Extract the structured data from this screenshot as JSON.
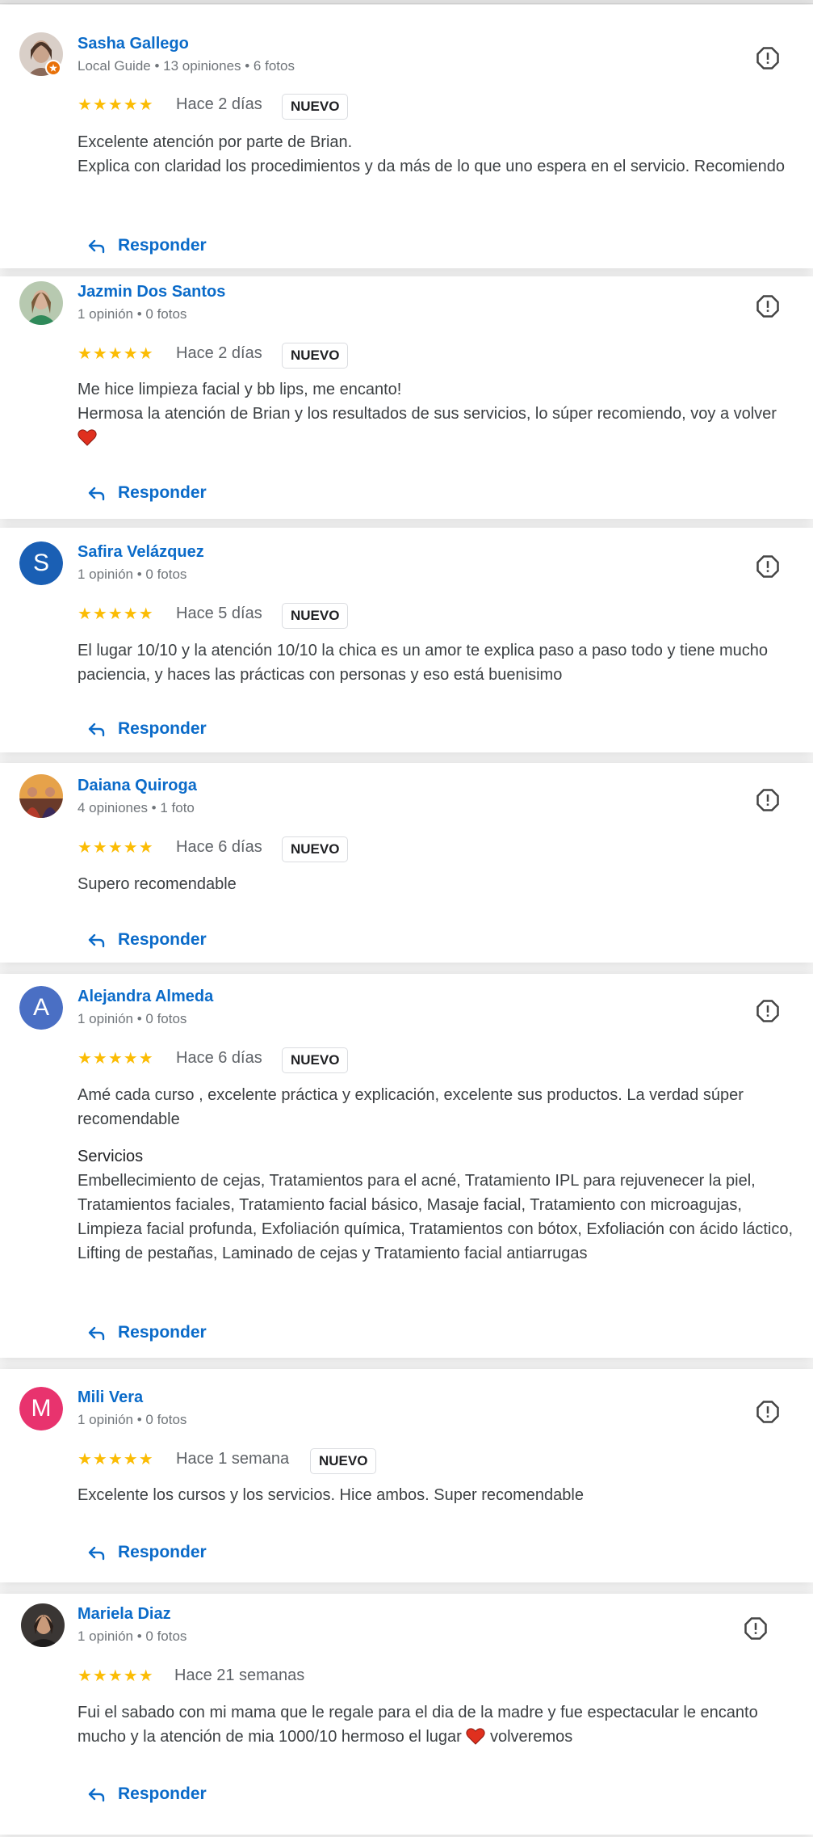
{
  "reviews": [
    {
      "name": "Sasha Gallego",
      "meta": "Local Guide • 13 opiniones • 6 fotos",
      "rating": 5,
      "stars": "★★★★★",
      "time": "Hace 2 días",
      "badge": "NUEVO",
      "lines": [
        "Excelente atención por parte de Brian.",
        "Explica con claridad los procedimientos y da más de lo que uno espera en el servicio. Recomiendo"
      ],
      "avatar_icon": "photo-avatar-icon"
    },
    {
      "name": "Jazmin Dos Santos",
      "meta": "1 opinión • 0 fotos",
      "rating": 5,
      "stars": "★★★★★",
      "time": "Hace 2 días",
      "badge": "NUEVO",
      "lines": [
        "Me hice limpieza facial y bb lips, me encanto!",
        "Hermosa la atención de Brian y los resultados de sus servicios, lo súper recomiendo, voy a volver"
      ],
      "avatar_icon": "photo-avatar-icon"
    },
    {
      "name": "Safira Velázquez",
      "meta": "1 opinión • 0 fotos",
      "rating": 5,
      "stars": "★★★★★",
      "time": "Hace 5 días",
      "badge": "NUEVO",
      "lines": [
        "El lugar 10/10 y la atención 10/10 la chica es un amor te explica paso a paso todo y tiene mucho paciencia, y haces las prácticas con personas y eso está buenisimo"
      ],
      "avatar_letter": "S",
      "avatar_color": "#1a5fb4"
    },
    {
      "name": "Daiana Quiroga",
      "meta": "4 opiniones • 1 foto",
      "rating": 5,
      "stars": "★★★★★",
      "time": "Hace 6 días",
      "badge": "NUEVO",
      "lines": [
        "Supero recomendable"
      ],
      "avatar_icon": "photo-avatar-icon"
    },
    {
      "name": "Alejandra Almeda",
      "meta": "1 opinión • 0 fotos",
      "rating": 5,
      "stars": "★★★★★",
      "time": "Hace 6 días",
      "badge": "NUEVO",
      "lines": [
        "Amé cada curso , excelente práctica y explicación, excelente sus productos. La verdad súper recomendable"
      ],
      "services_title": "Servicios",
      "services": "Embellecimiento de cejas, Tratamientos para el acné, Tratamiento IPL para rejuvenecer la piel, Tratamientos faciales, Tratamiento facial básico, Masaje facial, Tratamiento con microagujas, Limpieza facial profunda, Exfoliación química, Tratamientos con bótox, Exfoliación con ácido láctico, Lifting de pestañas, Laminado de cejas y Tratamiento facial antiarrugas",
      "avatar_letter": "A",
      "avatar_color": "#4a6fc4"
    },
    {
      "name": "Mili Vera",
      "meta": "1 opinión • 0 fotos",
      "rating": 5,
      "stars": "★★★★★",
      "time": "Hace 1 semana",
      "badge": "NUEVO",
      "lines": [
        "Excelente los cursos y los servicios. Hice ambos. Super recomendable"
      ],
      "avatar_letter": "M",
      "avatar_color": "#e8336e"
    },
    {
      "name": "Mariela Diaz",
      "meta": "1 opinión • 0 fotos",
      "rating": 5,
      "stars": "★★★★★",
      "time": "Hace 21 semanas",
      "lines": [
        "Fui el sabado con mi mama que le regale para el dia de la madre y fue espectacular le encanto mucho y la atención de mia 1000/10 hermoso el lugar",
        "volveremos"
      ],
      "avatar_icon": "photo-avatar-icon"
    }
  ],
  "reply_label": "Responder",
  "colors": {
    "link": "#0b6bc9",
    "star": "#fbbc04",
    "heart": "#e0301e"
  }
}
